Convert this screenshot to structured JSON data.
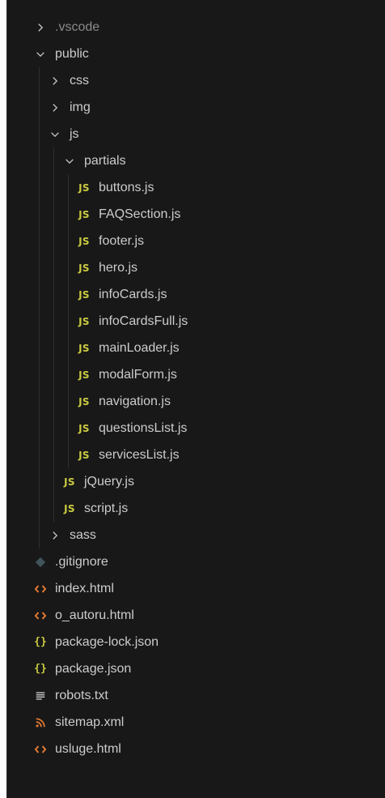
{
  "explorer": {
    "items": [
      {
        "label": ".vscode",
        "depth": 0,
        "kind": "folder",
        "expanded": false,
        "dim": true
      },
      {
        "label": "public",
        "depth": 0,
        "kind": "folder",
        "expanded": true
      },
      {
        "label": "css",
        "depth": 1,
        "kind": "folder",
        "expanded": false
      },
      {
        "label": "img",
        "depth": 1,
        "kind": "folder",
        "expanded": false
      },
      {
        "label": "js",
        "depth": 1,
        "kind": "folder",
        "expanded": true
      },
      {
        "label": "partials",
        "depth": 2,
        "kind": "folder",
        "expanded": true
      },
      {
        "label": "buttons.js",
        "depth": 3,
        "kind": "js",
        "icon_glyph": "JS"
      },
      {
        "label": "FAQSection.js",
        "depth": 3,
        "kind": "js",
        "icon_glyph": "JS"
      },
      {
        "label": "footer.js",
        "depth": 3,
        "kind": "js",
        "icon_glyph": "JS"
      },
      {
        "label": "hero.js",
        "depth": 3,
        "kind": "js",
        "icon_glyph": "JS"
      },
      {
        "label": "infoCards.js",
        "depth": 3,
        "kind": "js",
        "icon_glyph": "JS"
      },
      {
        "label": "infoCardsFull.js",
        "depth": 3,
        "kind": "js",
        "icon_glyph": "JS"
      },
      {
        "label": "mainLoader.js",
        "depth": 3,
        "kind": "js",
        "icon_glyph": "JS"
      },
      {
        "label": "modalForm.js",
        "depth": 3,
        "kind": "js",
        "icon_glyph": "JS"
      },
      {
        "label": "navigation.js",
        "depth": 3,
        "kind": "js",
        "icon_glyph": "JS"
      },
      {
        "label": "questionsList.js",
        "depth": 3,
        "kind": "js",
        "icon_glyph": "JS"
      },
      {
        "label": "servicesList.js",
        "depth": 3,
        "kind": "js",
        "icon_glyph": "JS"
      },
      {
        "label": "jQuery.js",
        "depth": 2,
        "kind": "js",
        "icon_glyph": "JS"
      },
      {
        "label": "script.js",
        "depth": 2,
        "kind": "js",
        "icon_glyph": "JS"
      },
      {
        "label": "sass",
        "depth": 1,
        "kind": "folder",
        "expanded": false
      },
      {
        "label": ".gitignore",
        "depth": 0,
        "kind": "git"
      },
      {
        "label": "index.html",
        "depth": 0,
        "kind": "html"
      },
      {
        "label": "o_autoru.html",
        "depth": 0,
        "kind": "html"
      },
      {
        "label": "package-lock.json",
        "depth": 0,
        "kind": "json",
        "icon_glyph": "{}"
      },
      {
        "label": "package.json",
        "depth": 0,
        "kind": "json",
        "icon_glyph": "{}"
      },
      {
        "label": "robots.txt",
        "depth": 0,
        "kind": "txt"
      },
      {
        "label": "sitemap.xml",
        "depth": 0,
        "kind": "rss"
      },
      {
        "label": "usluge.html",
        "depth": 0,
        "kind": "html"
      }
    ]
  },
  "colors": {
    "background": "#181818",
    "text": "#cccccc",
    "js_icon": "#cbcb41",
    "html_icon": "#e37933",
    "git_icon": "#41535b"
  }
}
